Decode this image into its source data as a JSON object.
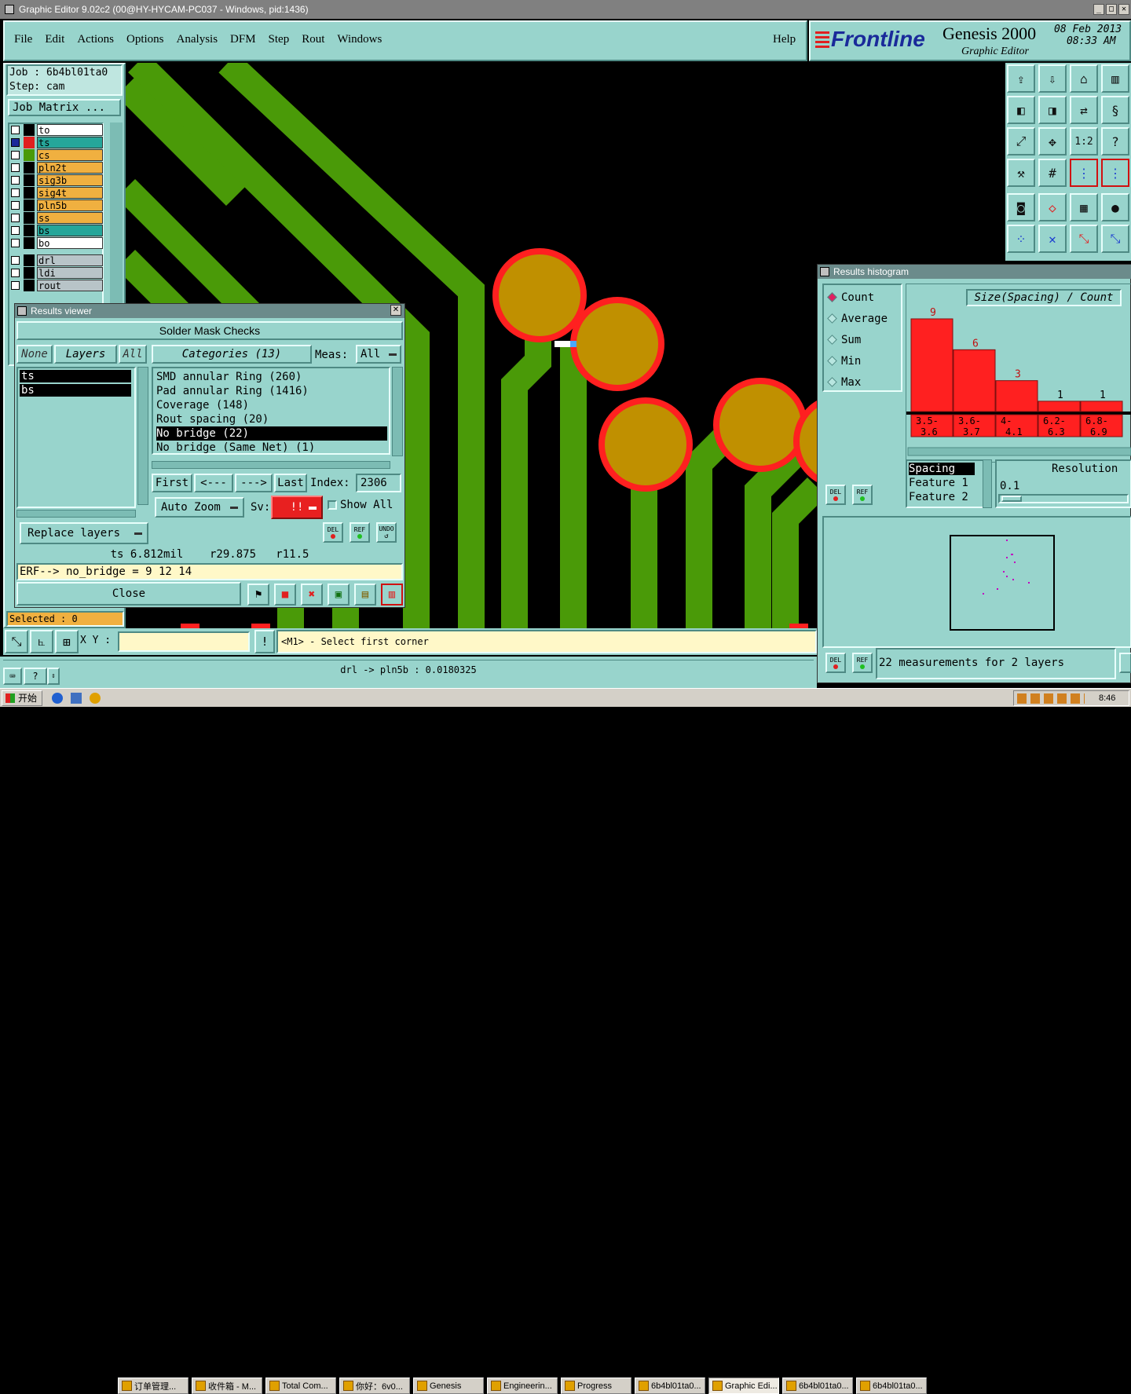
{
  "window": {
    "title": "Graphic Editor 9.02c2 (00@HY-HYCAM-PC037 - Windows, pid:1436)"
  },
  "menu": {
    "items": [
      "File",
      "Edit",
      "Actions",
      "Options",
      "Analysis",
      "DFM",
      "Step",
      "Rout",
      "Windows"
    ],
    "help": "Help"
  },
  "brand": {
    "logo": "Frontline",
    "product": "Genesis 2000",
    "subtitle": "Graphic Editor",
    "date": "08 Feb 2013",
    "time": "08:33 AM"
  },
  "job": {
    "job_label": "Job : 6b4bl01ta0",
    "step_label": "Step: cam",
    "matrix_button": "Job Matrix ..."
  },
  "layers": [
    {
      "name": "to",
      "color": "#ffffff"
    },
    {
      "name": "ts",
      "color": "#26a69a"
    },
    {
      "name": "cs",
      "color": "#f0b040"
    },
    {
      "name": "pln2t",
      "color": "#f0b040"
    },
    {
      "name": "sig3b",
      "color": "#f0b040"
    },
    {
      "name": "sig4t",
      "color": "#f0b040"
    },
    {
      "name": "pln5b",
      "color": "#f0b040"
    },
    {
      "name": "ss",
      "color": "#f0b040"
    },
    {
      "name": "bs",
      "color": "#26a69a"
    },
    {
      "name": "bo",
      "color": "#ffffff"
    },
    {
      "name": "drl",
      "color": "#b8c4c8"
    },
    {
      "name": "ldi",
      "color": "#b8c4c8"
    },
    {
      "name": "rout",
      "color": "#b8c4c8"
    }
  ],
  "selected": "Selected : 0",
  "results_viewer": {
    "title": "Results viewer",
    "header": "Solder Mask Checks",
    "none_btn": "None",
    "layers_btn": "Layers",
    "all_btn": "All",
    "categories_btn": "Categories (13)",
    "meas_label": "Meas:",
    "meas_value": "All",
    "layer_list": [
      "ts",
      "bs"
    ],
    "categories": [
      "SMD annular Ring (260)",
      "Pad annular Ring (1416)",
      "Coverage (148)",
      "Rout spacing (20)",
      "No bridge (22)",
      "No bridge (Same Net) (1)"
    ],
    "selected_category": "No bridge (22)",
    "first_btn": "First",
    "prev_btn": "<---",
    "next_btn": "--->",
    "last_btn": "Last",
    "index_label": "Index:",
    "index_value": "2306",
    "auto_zoom": "Auto Zoom",
    "sv_label": "Sv:",
    "sv_value": "!!",
    "show_all": "Show All",
    "replace_layers": "Replace layers",
    "del": "DEL",
    "ref": "REF",
    "undo": "UNDO",
    "measure": "ts 6.812mil    r29.875   r11.5",
    "erf": "ERF--> no_bridge = 9 12 14",
    "close": "Close"
  },
  "histogram": {
    "title": "Results histogram",
    "modes": [
      "Count",
      "Average",
      "Sum",
      "Min",
      "Max"
    ],
    "selected_mode": "Count",
    "chart_label": "Size(Spacing) / Count",
    "measure_list": [
      "Spacing",
      "Feature 1",
      "Feature 2"
    ],
    "resolution_label": "Resolution",
    "resolution_value": "0.1",
    "del": "DEL",
    "ref": "REF",
    "summary": "22 measurements for 2 layers"
  },
  "chart_data": {
    "type": "bar",
    "categories": [
      "3.5-3.6",
      "3.6-3.7",
      "4-4.1",
      "6.2-6.3",
      "6.8-6.9"
    ],
    "values": [
      9,
      6,
      3,
      1,
      1
    ],
    "ylim": [
      0,
      9
    ],
    "title": "Size(Spacing) / Count",
    "xlabel": "",
    "ylabel": ""
  },
  "bottom": {
    "xy_label": "X Y :",
    "xy_value": "",
    "prompt": "<M1> - Select first corner",
    "status": "drl -> pln5b : 0.0180325"
  },
  "taskbar": {
    "start": "开始",
    "clock": "8:46",
    "tasks": [
      "订单管理...",
      "收件箱 - M...",
      "Total Com...",
      "你好：6v0...",
      "Genesis",
      "Engineerin...",
      "Progress",
      "6b4bl01ta0...",
      "Graphic Edi...",
      "6b4bl01ta0...",
      "6b4bl01ta0..."
    ]
  },
  "colors": {
    "panel": "#98d4cc",
    "trace": "#4a9a08",
    "pad": "#c09000",
    "pad_outline": "#ff2020",
    "bar": "#ff2020"
  }
}
